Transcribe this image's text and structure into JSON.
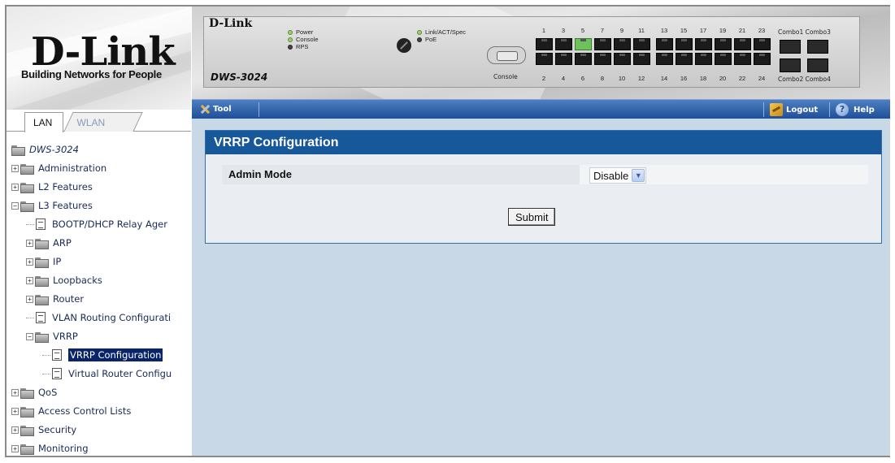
{
  "brand": {
    "logo": "D-Link",
    "tagline": "Building Networks for People",
    "device_logo": "D-Link",
    "device_model": "DWS-3024"
  },
  "nav_tabs": [
    {
      "label": "LAN",
      "active": true
    },
    {
      "label": "WLAN",
      "active": false
    }
  ],
  "tree": {
    "root": "DWS-3024",
    "items": [
      {
        "label": "Administration",
        "level": 1,
        "type": "folder",
        "expander": "+"
      },
      {
        "label": "L2 Features",
        "level": 1,
        "type": "folder",
        "expander": "+"
      },
      {
        "label": "L3 Features",
        "level": 1,
        "type": "folder-open",
        "expander": "-"
      },
      {
        "label": "BOOTP/DHCP Relay Ager",
        "level": 2,
        "type": "page"
      },
      {
        "label": "ARP",
        "level": 2,
        "type": "folder",
        "expander": "+"
      },
      {
        "label": "IP",
        "level": 2,
        "type": "folder",
        "expander": "+"
      },
      {
        "label": "Loopbacks",
        "level": 2,
        "type": "folder",
        "expander": "+"
      },
      {
        "label": "Router",
        "level": 2,
        "type": "folder",
        "expander": "+"
      },
      {
        "label": "VLAN Routing Configurati",
        "level": 2,
        "type": "page"
      },
      {
        "label": "VRRP",
        "level": 2,
        "type": "folder-open",
        "expander": "-"
      },
      {
        "label": "VRRP Configuration",
        "level": 3,
        "type": "page",
        "selected": true
      },
      {
        "label": "Virtual Router Configu",
        "level": 3,
        "type": "page"
      },
      {
        "label": "QoS",
        "level": 1,
        "type": "folder",
        "expander": "+"
      },
      {
        "label": "Access Control Lists",
        "level": 1,
        "type": "folder",
        "expander": "+"
      },
      {
        "label": "Security",
        "level": 1,
        "type": "folder",
        "expander": "+"
      },
      {
        "label": "Monitoring",
        "level": 1,
        "type": "folder",
        "expander": "+"
      }
    ]
  },
  "device": {
    "leds_left": [
      "Power",
      "Console",
      "RPS"
    ],
    "leds_right": [
      "Link/ACT/Spec",
      "PoE"
    ],
    "console_label": "Console",
    "ports_top": [
      "1",
      "3",
      "5",
      "7",
      "9",
      "11",
      "13",
      "15",
      "17",
      "19",
      "21",
      "23"
    ],
    "ports_bottom": [
      "2",
      "4",
      "6",
      "8",
      "10",
      "12",
      "14",
      "16",
      "18",
      "20",
      "22",
      "24"
    ],
    "active_port": "5",
    "combo_top": "Combo1 Combo3",
    "combo_bottom": "Combo2 Combo4"
  },
  "toolbar": {
    "tool_label": "Tool",
    "logout_label": "Logout",
    "help_label": "Help"
  },
  "panel": {
    "title": "VRRP Configuration",
    "field_label": "Admin Mode",
    "field_value": "Disable",
    "submit_label": "Submit"
  },
  "colors": {
    "accent": "#16589a",
    "toolbar": "#1f4f98",
    "content_bg": "#c8d8e6",
    "selected": "#0a246a",
    "active_port": "#6cc35a"
  }
}
